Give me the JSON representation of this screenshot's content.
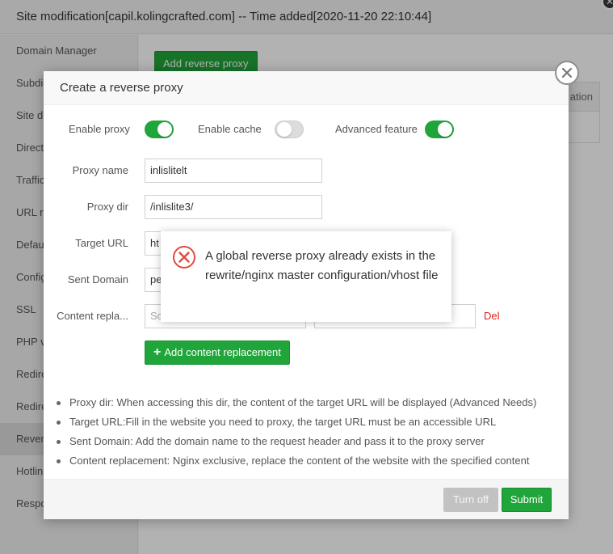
{
  "window": {
    "title": "Site modification[capil.kolingcrafted.com] -- Time added[2020-11-20 22:10:44]",
    "close_glyph": "✕"
  },
  "sidebar": {
    "items": [
      {
        "label": "Domain Manager"
      },
      {
        "label": "Subdi"
      },
      {
        "label": "Site d"
      },
      {
        "label": "Direct"
      },
      {
        "label": "Traffic"
      },
      {
        "label": "URL re"
      },
      {
        "label": "Defau"
      },
      {
        "label": "Config"
      },
      {
        "label": "SSL"
      },
      {
        "label": "PHP v"
      },
      {
        "label": "Redire"
      },
      {
        "label": "Redire"
      },
      {
        "label": "Rever"
      },
      {
        "label": "Hotlin"
      },
      {
        "label": "Respo"
      }
    ]
  },
  "main": {
    "add_reverse_proxy_label": "Add reverse proxy",
    "table_header_fragment": "ation"
  },
  "dialog": {
    "title": "Create a reverse proxy",
    "toggles": {
      "enable_proxy": {
        "label": "Enable proxy",
        "on": true
      },
      "enable_cache": {
        "label": "Enable cache",
        "on": false
      },
      "advanced_feature": {
        "label": "Advanced feature",
        "on": true
      }
    },
    "fields": {
      "proxy_name": {
        "label": "Proxy name",
        "value": "inlislitelt"
      },
      "proxy_dir": {
        "label": "Proxy dir",
        "value": "/inlislite3/"
      },
      "target_url": {
        "label": "Target URL",
        "value": "ht"
      },
      "sent_domain": {
        "label": "Sent Domain",
        "value": "pe"
      },
      "content_replacement": {
        "label": "Content repla...",
        "placeholder": "Sc",
        "replace_placeholder": ""
      }
    },
    "del_label": "Del",
    "add_content_replacement_label": "Add content replacement",
    "tips": [
      "Proxy dir: When accessing this dir, the content of the target URL will be displayed (Advanced Needs)",
      "Target URL:Fill in the website you need to proxy, the target URL must be an accessible URL",
      "Sent Domain: Add the domain name to the request header and pass it to the proxy server",
      "Content replacement: Nginx exclusive, replace the content of the website with the specified content"
    ],
    "buttons": {
      "turn_off": "Turn off",
      "submit": "Submit"
    }
  },
  "error_message": {
    "text": "A global reverse proxy already exists in the rewrite/nginx master configuration/vhost file",
    "icon": "error-circle-x-icon",
    "color": "#e04b3f"
  },
  "colors": {
    "accent": "#20a53a",
    "danger": "#e02020"
  }
}
